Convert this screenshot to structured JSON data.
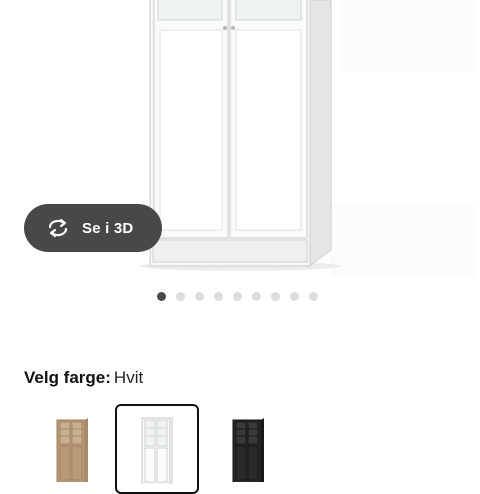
{
  "view_3d": {
    "label": "Se i 3D",
    "icon": "rotate-3d-icon"
  },
  "carousel": {
    "dot_count": 9,
    "active_index": 0
  },
  "color_picker": {
    "label": "Velg farge:",
    "selected_value": "Hvit",
    "swatches": [
      {
        "color_name": "oak-effect",
        "color": "#b89a78",
        "selected": false
      },
      {
        "color_name": "white",
        "color": "#f6f6f6",
        "selected": true
      },
      {
        "color_name": "black-brown",
        "color": "#2a2a2a",
        "selected": false
      }
    ]
  },
  "colors": {
    "accent_dark": "#484848",
    "dot_inactive": "#dcdcdc"
  }
}
